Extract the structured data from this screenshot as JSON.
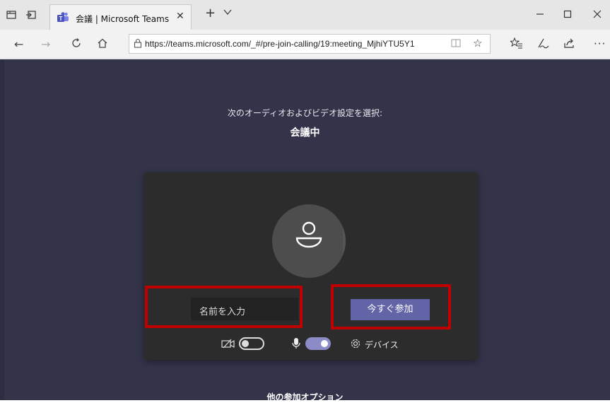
{
  "browser": {
    "tab": {
      "title": "会議 | Microsoft Teams"
    },
    "address_bar": {
      "url": "https://teams.microsoft.com/_#/pre-join-calling/19:meeting_MjhiYTU5Y1"
    }
  },
  "prejoin": {
    "prompt": "次のオーディオおよびビデオ設定を選択:",
    "meeting_title": "会議中",
    "name_input": {
      "placeholder": "名前を入力",
      "value": ""
    },
    "join_button": "今すぐ参加",
    "camera_toggle": {
      "on": false
    },
    "mic_toggle": {
      "on": true
    },
    "devices_label": "デバイス",
    "other_options": "他の参加オプション"
  },
  "colors": {
    "page_bg": "#33344a",
    "card_bg": "#2d2c2c",
    "accent": "#6264a7",
    "highlight": "#c00000"
  }
}
